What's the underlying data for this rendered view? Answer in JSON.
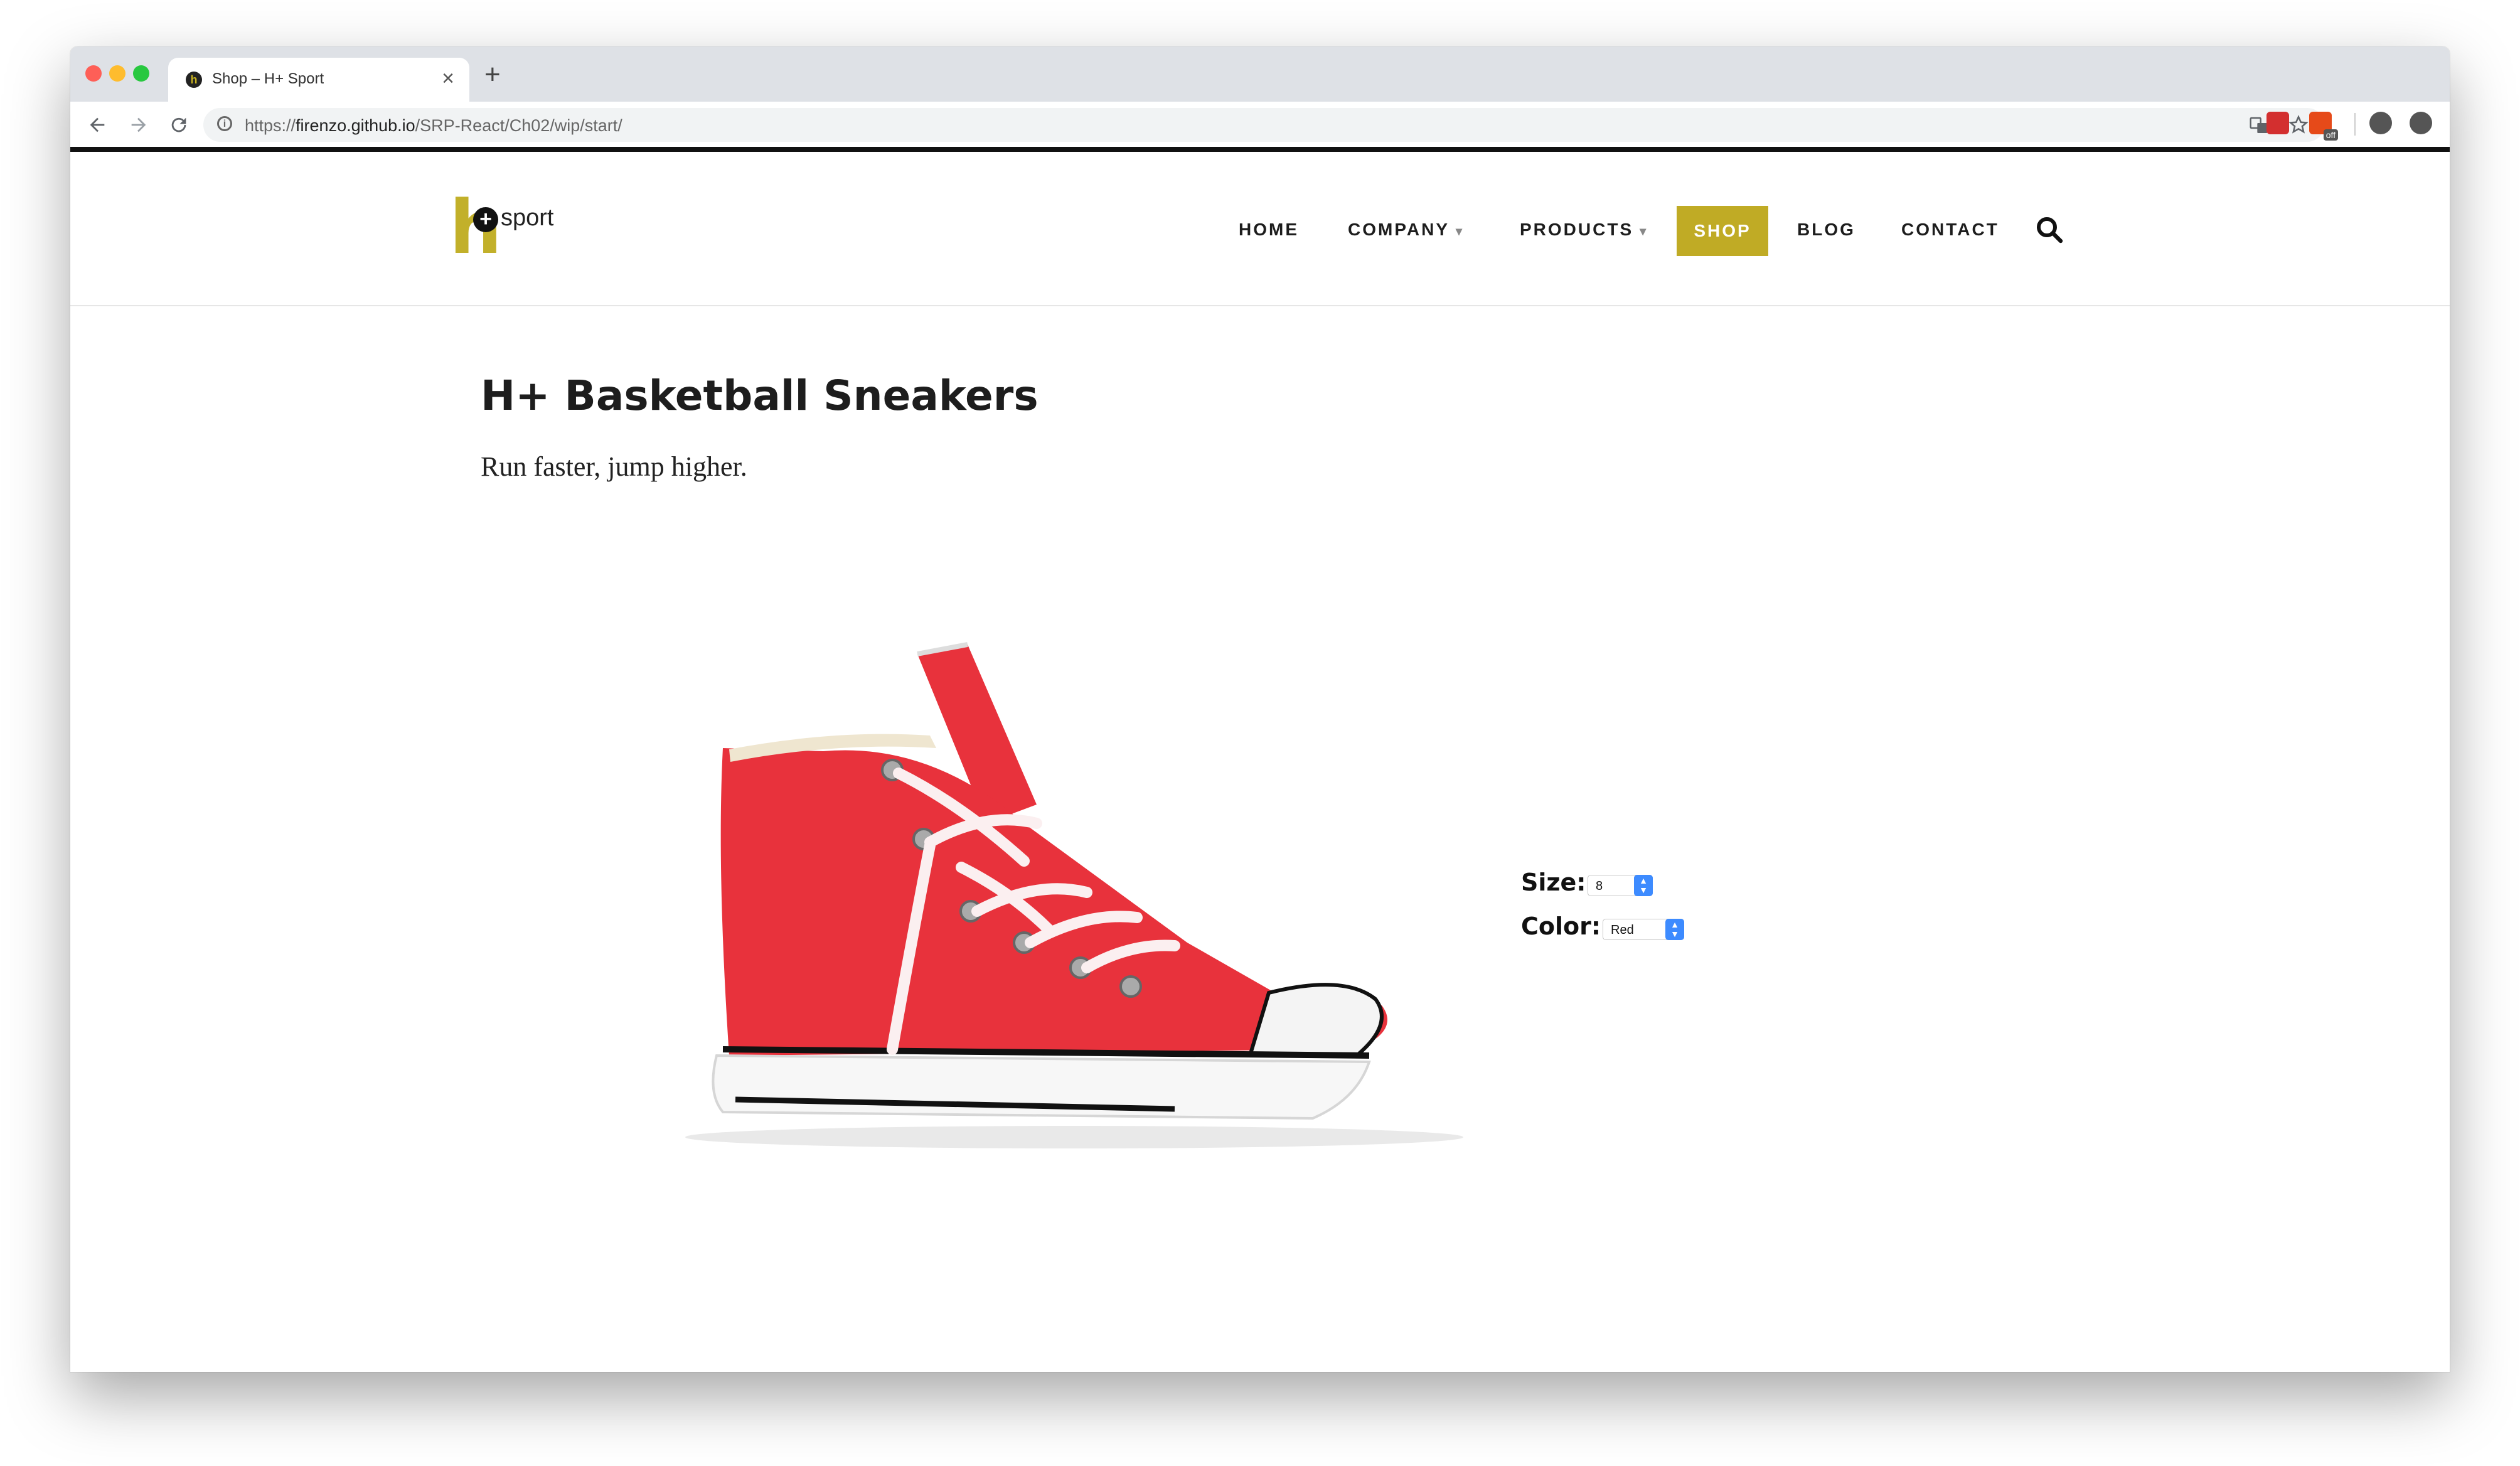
{
  "browser": {
    "tab_title": "Shop – H+ Sport",
    "tab_favicon": "h",
    "close_glyph": "×",
    "new_tab_glyph": "+",
    "url_scheme": "https://",
    "url_host": "firenzo.github.io",
    "url_path": "/SRP-React/Ch02/wip/start/",
    "extension_badge": "off"
  },
  "logo": {
    "mark": "h",
    "plus": "+",
    "word": "sport"
  },
  "nav": {
    "home": "HOME",
    "company": "COMPANY",
    "products": "PRODUCTS",
    "shop": "SHOP",
    "blog": "BLOG",
    "contact": "CONTACT",
    "caret": "▾"
  },
  "product": {
    "title": "H+ Basketball Sneakers",
    "description": "Run faster, jump higher.",
    "size_label": "Size:",
    "size_value": "8",
    "color_label": "Color:",
    "color_value": "Red"
  },
  "colors": {
    "accent": "#c0ab25",
    "shoe_canvas": "#e8323c"
  }
}
